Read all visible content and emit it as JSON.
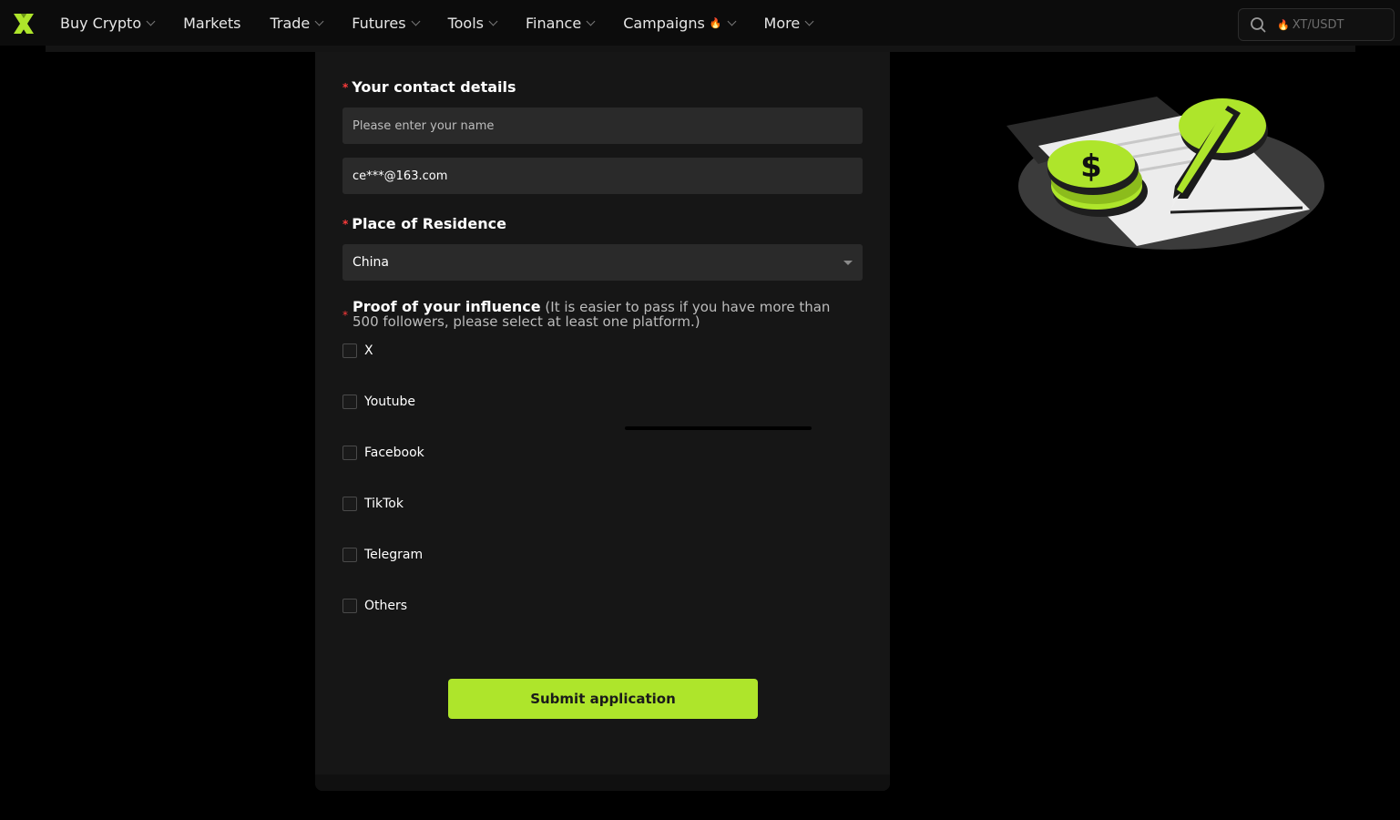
{
  "nav": {
    "items": [
      {
        "label": "Buy Crypto",
        "dropdown": true
      },
      {
        "label": "Markets",
        "dropdown": false
      },
      {
        "label": "Trade",
        "dropdown": true
      },
      {
        "label": "Futures",
        "dropdown": true
      },
      {
        "label": "Tools",
        "dropdown": true
      },
      {
        "label": "Finance",
        "dropdown": true
      },
      {
        "label": "Campaigns",
        "dropdown": true,
        "hot": true
      },
      {
        "label": "More",
        "dropdown": true
      }
    ],
    "search_placeholder": "XT/USDT"
  },
  "form": {
    "contact": {
      "label": "Your contact details",
      "name_placeholder": "Please enter your name",
      "name_value": "",
      "email_value": "ce***@163.com"
    },
    "residence": {
      "label": "Place of Residence",
      "selected": "China"
    },
    "influence": {
      "label": "Proof of your influence",
      "hint": "(It is easier to pass if you have more than 500 followers, please select at least one platform.)",
      "platforms": [
        "X",
        "Youtube",
        "Facebook",
        "TikTok",
        "Telegram",
        "Others"
      ]
    },
    "submit_label": "Submit application"
  },
  "colors": {
    "accent": "#aee52b",
    "required": "#ff3b3b",
    "background": "#000000",
    "panel": "#161616",
    "input": "#2a2a2a"
  },
  "icons": [
    "xt-logo-icon",
    "chevron-down-icon",
    "flame-icon",
    "search-icon",
    "caret-down-icon",
    "coins-document-pen-illustration"
  ]
}
